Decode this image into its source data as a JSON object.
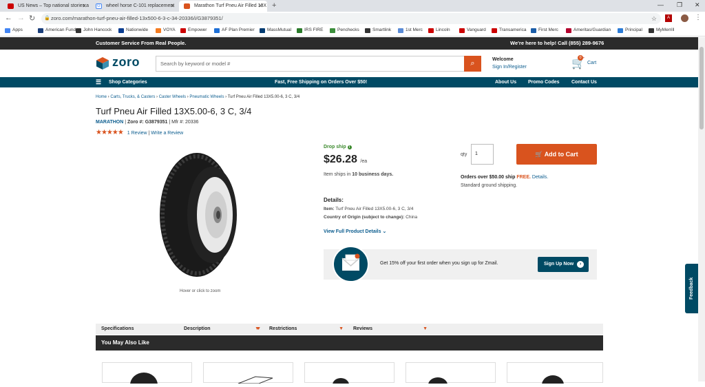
{
  "browser": {
    "tabs": [
      {
        "title": "US News – Top national stories a",
        "favicon_color": "#cc0000"
      },
      {
        "title": "wheel horse C-101 replacement",
        "favicon_color": "#4285f4"
      },
      {
        "title": "Marathon Turf Pneu Air Filled 13X",
        "favicon_color": "#d9531e"
      }
    ],
    "url": "zoro.com/marathon-turf-pneu-air-filled-13x500-6-3-c-34-20336/i/G3879351/",
    "bookmarks": [
      "Apps",
      "American Funds",
      "John Hancock",
      "Nationwide",
      "VOYA",
      "Empower",
      "AF Plan Premier",
      "MassMutual",
      "IRS FIRE",
      "Penchecks",
      "Smartlink",
      "1st Merc",
      "Lincoln",
      "Vanguard",
      "Transamerica",
      "First Merc",
      "Ameritas/Guardian",
      "Principal",
      "MyMerrill"
    ]
  },
  "site": {
    "topbar_left": "Customer Service From Real People.",
    "topbar_right": "We're here to help! Call (855) 289-9676",
    "logo_text": "zoro",
    "search_placeholder": "Search by keyword or model #",
    "welcome": "Welcome",
    "signin": "Sign In/Register",
    "cart_label": "Cart",
    "cart_count": "0",
    "nav": {
      "shop": "Shop Categories",
      "shipping": "Fast, Free Shipping on Orders Over $50!",
      "about": "About Us",
      "promo": "Promo Codes",
      "contact": "Contact Us"
    }
  },
  "product": {
    "breadcrumbs": [
      "Home",
      "Carts, Trucks, & Casters",
      "Caster Wheels",
      "Pneumatic Wheels",
      "Turf Pneu Air Filled 13X5.00-6, 3 C, 3/4"
    ],
    "title": "Turf Pneu Air Filled 13X5.00-6, 3 C, 3/4",
    "brand": "MARATHON",
    "zoro_label": "Zoro #:",
    "zoro_num": "G3879351",
    "mfr_label": "Mfr #:",
    "mfr_num": "20336",
    "rating": 5,
    "review_count": "1 Review",
    "write_review": "Write a Review",
    "image_hint": "Hover or click to zoom",
    "drop_ship": "Drop ship",
    "price": "$26.28",
    "price_unit": "/ea",
    "ships_pre": "Item ships in",
    "ships_days": "10 business days.",
    "details_heading": "Details:",
    "item_label": "Item:",
    "item_value": "Turf Pneu Air Filled 13X5.00-6, 3 C, 3/4",
    "origin_label": "Country of Origin (subject to change):",
    "origin_value": "China",
    "view_details": "View Full Product Details",
    "qty_label": "qty",
    "qty_value": "1",
    "add_to_cart": "Add to Cart",
    "free_ship_pre": "Orders over $50.00 ship",
    "free_word": "FREE.",
    "details_link": "Details.",
    "standard_ship": "Standard ground shipping.",
    "zmail_text": "Get 15% off your first order when you sign up for Zmail.",
    "signup": "Sign Up Now"
  },
  "tabs": [
    "Specifications",
    "Description",
    "Restrictions",
    "Reviews"
  ],
  "also_like": "You May Also Like",
  "feedback": "Feedback",
  "colors": {
    "accent": "#d9531e",
    "navy": "#004a64",
    "link": "#0b5c8e",
    "green": "#3c8a2e"
  }
}
